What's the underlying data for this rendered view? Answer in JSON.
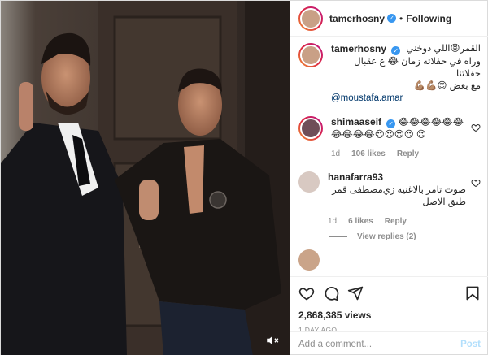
{
  "post": {
    "username": "tamerhosny",
    "follow_label": "Following",
    "separator": "•"
  },
  "caption": {
    "username": "tamerhosny",
    "text_line1": "القمر😝اللي دوخني",
    "text_line2": "وراه في حفلاته زمان 😂 ع عقبال حفلاتنا",
    "text_line3": "مع بعض 😍💪🏽💪🏽",
    "mention": "@moustafa.amar"
  },
  "comments": [
    {
      "username": "shimaaseif",
      "verified": true,
      "text": "😂😂😂😂😂😂 😂😂😂😂😍😍😍😍 😍",
      "age": "1d",
      "likes": "106 likes",
      "reply_label": "Reply"
    },
    {
      "username": "hanafarra93",
      "verified": false,
      "text_line1": "صوت تامر بالاغنية زي",
      "text_line2": "مصطفى قمر طبق الاصل",
      "age": "1d",
      "likes": "6 likes",
      "reply_label": "Reply",
      "view_replies": "View replies (2)"
    }
  ],
  "stats": {
    "views": "2,868,385 views",
    "age": "1 DAY AGO"
  },
  "add_comment": {
    "placeholder": "Add a comment...",
    "post_label": "Post"
  },
  "colors": {
    "verified": "#3897f0",
    "link": "#00376b",
    "muted": "#8e8e8e",
    "post_disabled": "#b2dffc"
  }
}
